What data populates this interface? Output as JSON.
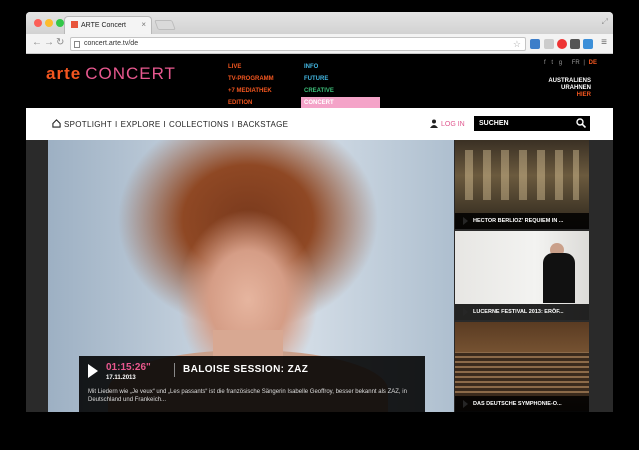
{
  "browser": {
    "tab_title": "ARTE Concert",
    "url": "concert.arte.tv/de"
  },
  "header": {
    "logo_arte": "arte",
    "logo_concert": "CONCERT",
    "nav_col1": [
      "LIVE",
      "TV-PROGRAMM",
      "+7 MEDIATHEK",
      "EDITION"
    ],
    "nav_col2": [
      "INFO",
      "FUTURE",
      "CREATIVE",
      "CONCERT"
    ],
    "lang_fr": "FR",
    "lang_sep": "|",
    "lang_de": "DE",
    "promo_line1": "AUSTRALIENS",
    "promo_line2": "URAHNEN",
    "promo_line3": "HIER"
  },
  "mainnav": {
    "items": [
      "SPOTLIGHT",
      "EXPLORE",
      "COLLECTIONS",
      "BACKSTAGE"
    ],
    "separator": "I",
    "login": "LOG IN",
    "search_placeholder": "SUCHEN"
  },
  "feature": {
    "duration": "01:15:26\"",
    "date": "17.11.2013",
    "title": "BALOISE SESSION: ZAZ",
    "description": "Mit Liedern wie „Je veux“ und „Les passants“ ist die französische Sängerin Isabelle Geoffroy, besser bekannt als ZAZ, in Deutschland und Frankeich..."
  },
  "sidebar": [
    {
      "label": "HECTOR BERLIOZ' REQUIEM IN ..."
    },
    {
      "label": "LUCERNE FESTIVAL 2013: ERÖF..."
    },
    {
      "label": "DAS DEUTSCHE SYMPHONIE-O..."
    }
  ],
  "colors": {
    "arte_orange": "#f3561f",
    "concert_pink": "#e8588f",
    "nav_blue": "#43b7e2",
    "highlight_pink": "#f4a3c8"
  }
}
